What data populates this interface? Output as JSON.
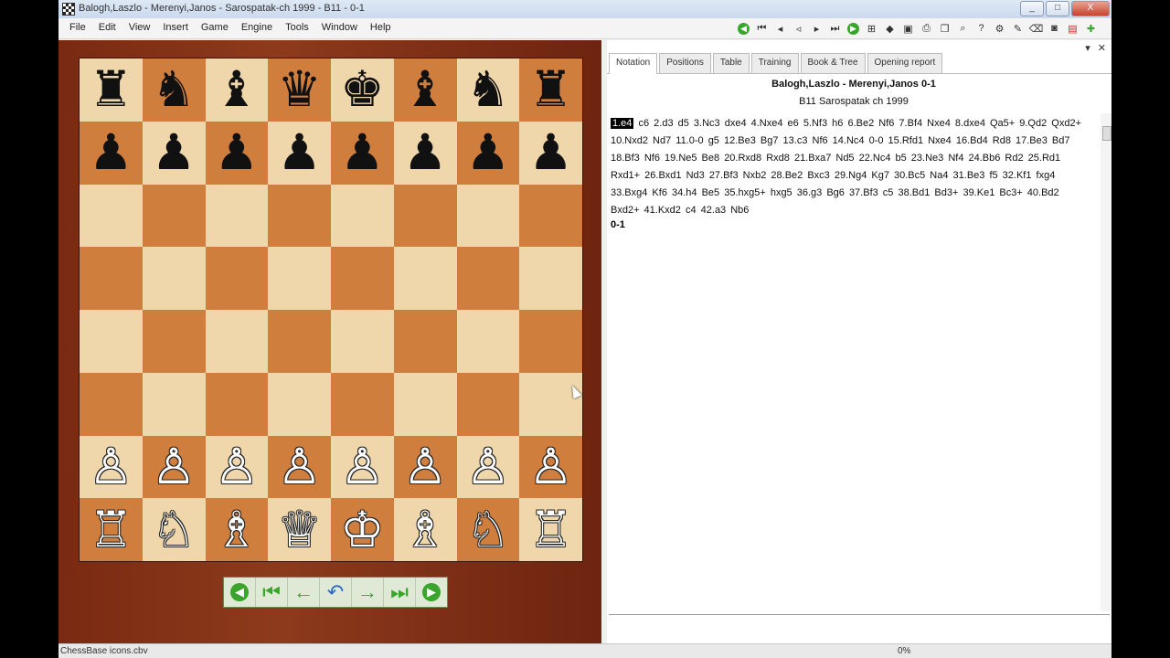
{
  "window": {
    "title": "Balogh,Laszlo - Merenyi,Janos - Sarospatak-ch 1999 - B11 - 0-1",
    "buttons": [
      "_",
      "□",
      "X"
    ]
  },
  "menu": [
    "File",
    "Edit",
    "View",
    "Insert",
    "Game",
    "Engine",
    "Tools",
    "Window",
    "Help"
  ],
  "toolbar": {
    "icons": [
      "go-start-icon",
      "first-icon",
      "back-icon",
      "back-step-icon",
      "forward-icon",
      "last-icon",
      "go-end-icon",
      "new-game-icon",
      "replace-icon",
      "save-icon",
      "print-icon",
      "copy-icon",
      "search-icon",
      "help-icon",
      "settings-icon",
      "tools-icon",
      "erase-icon",
      "camera-icon",
      "pdf-icon",
      "plus-icon"
    ]
  },
  "board": {
    "ranks": [
      [
        "♜",
        "♞",
        "♝",
        "♛",
        "♚",
        "♝",
        "♞",
        "♜"
      ],
      [
        "♟",
        "♟",
        "♟",
        "♟",
        "♟",
        "♟",
        "♟",
        "♟"
      ],
      [
        "",
        "",
        "",
        "",
        "",
        "",
        "",
        ""
      ],
      [
        "",
        "",
        "",
        "",
        "",
        "",
        "",
        ""
      ],
      [
        "",
        "",
        "",
        "",
        "",
        "",
        "",
        ""
      ],
      [
        "",
        "",
        "",
        "",
        "",
        "",
        "",
        ""
      ],
      [
        "♙",
        "♙",
        "♙",
        "♙",
        "♙",
        "♙",
        "♙",
        "♙"
      ],
      [
        "♖",
        "♘",
        "♗",
        "♕",
        "♔",
        "♗",
        "♘",
        "♖"
      ]
    ],
    "light_color": "#f0d7ab",
    "dark_color": "#cf7e3e"
  },
  "nav_buttons": [
    {
      "name": "go-back-circle-button",
      "glyph": "◀"
    },
    {
      "name": "first-move-button",
      "glyph": "⏮"
    },
    {
      "name": "previous-move-button",
      "glyph": "←"
    },
    {
      "name": "undo-button",
      "glyph": "↶"
    },
    {
      "name": "next-move-button",
      "glyph": "→"
    },
    {
      "name": "last-move-button",
      "glyph": "⏭"
    },
    {
      "name": "go-forward-circle-button",
      "glyph": "▶"
    }
  ],
  "notation": {
    "panel_controls": [
      "▾",
      "✕"
    ],
    "tabs": [
      "Notation",
      "Positions",
      "Table",
      "Training",
      "Book & Tree",
      "Opening report"
    ],
    "players": "Balogh,Laszlo - Merenyi,Janos  0-1",
    "event": "B11 Sarospatak ch 1999",
    "first_move": "1.e4",
    "moves": "c6  2.d3  d5  3.Nc3  dxe4  4.Nxe4  e6  5.Nf3  h6  6.Be2  Nf6  7.Bf4  Nxe4  8.dxe4  Qa5+  9.Qd2  Qxd2+  10.Nxd2  Nd7  11.0-0  g5  12.Be3  Bg7  13.c3  Nf6  14.Nc4  0-0  15.Rfd1  Nxe4  16.Bd4  Rd8  17.Be3  Bd7  18.Bf3  Nf6  19.Ne5  Be8  20.Rxd8  Rxd8  21.Bxa7  Nd5  22.Nc4  b5  23.Ne3  Nf4  24.Bb6  Rd2  25.Rd1  Rxd1+  26.Bxd1  Nd3  27.Bf3  Nxb2  28.Be2  Bxc3  29.Ng4  Kg7  30.Bc5  Na4  31.Be3  f5  32.Kf1  fxg4  33.Bxg4  Kf6  34.h4  Be5  35.hxg5+  hxg5  36.g3  Bg6  37.Bf3  c5  38.Bd1  Bd3+  39.Ke1  Bc3+  40.Bd2  Bxd2+  41.Kxd2  c4  42.a3  Nb6",
    "result": "0-1"
  },
  "status": {
    "left": "ChessBase icons.cbv",
    "mid": "0%"
  }
}
